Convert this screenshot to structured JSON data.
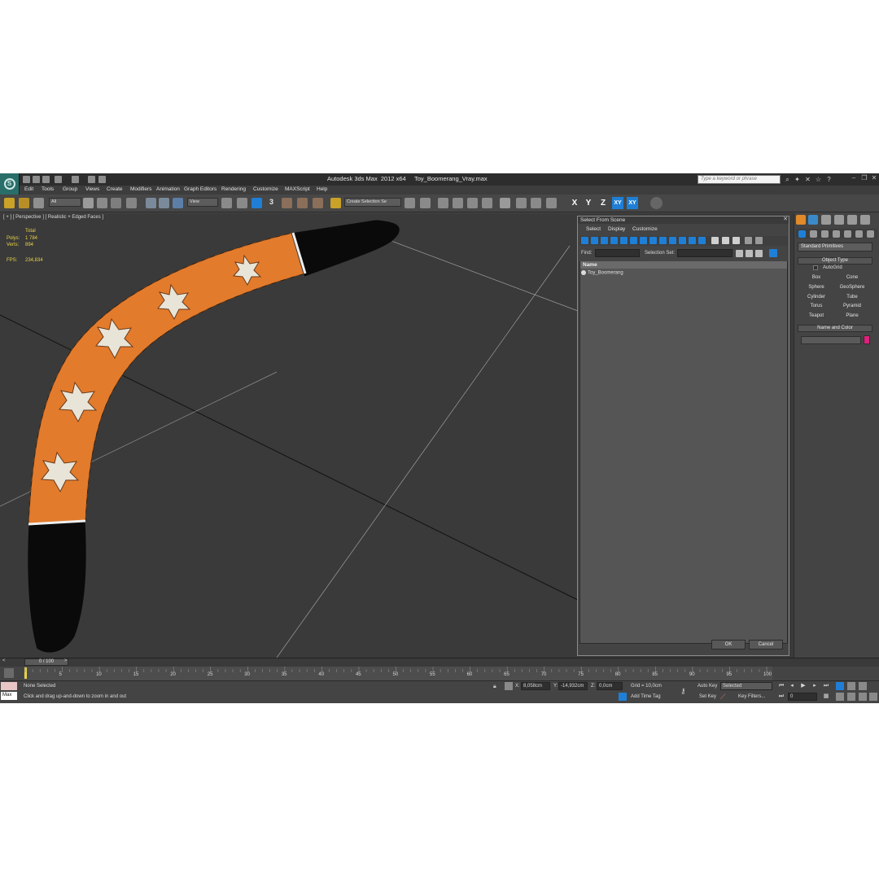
{
  "app": {
    "title": "Autodesk 3ds Max  2012 x64     Toy_Boomerang_Vray.max",
    "search_placeholder": "Type a keyword or phrase",
    "logo_letter": "S"
  },
  "menu": [
    "Edit",
    "Tools",
    "Group",
    "Views",
    "Create",
    "Modifiers",
    "Animation",
    "Graph Editors",
    "Rendering",
    "Customize",
    "MAXScript",
    "Help"
  ],
  "toolbar": {
    "filter_dropdown": "All",
    "coord_dropdown": "View",
    "snap_label": "3",
    "selection_set_placeholder": "Create Selection Se",
    "axes": [
      "X",
      "Y",
      "Z",
      "XY",
      "XY"
    ]
  },
  "viewport": {
    "label": "[ + ] [ Perspective ] [ Realistic + Edged Faces ]",
    "stats": {
      "total_label": "Total",
      "polys_label": "Polys:",
      "polys_value": "1 784",
      "verts_label": "Verts:",
      "verts_value": "894",
      "fps_label": "FPS:",
      "fps_value": "234,834"
    }
  },
  "dialog": {
    "title": "Select From Scene",
    "menu": [
      "Select",
      "Display",
      "Customize"
    ],
    "find_label": "Find:",
    "selection_set_label": "Selection Set:",
    "column_name": "Name",
    "items": [
      "Toy_Boomerang"
    ],
    "ok_label": "OK",
    "cancel_label": "Cancel"
  },
  "command_panel": {
    "category": "Standard Primitives",
    "object_type_title": "Object Type",
    "autogrid_label": "AutoGrid",
    "primitives": [
      "Box",
      "Cone",
      "Sphere",
      "GeoSphere",
      "Cylinder",
      "Tube",
      "Torus",
      "Pyramid",
      "Teapot",
      "Plane"
    ],
    "name_color_title": "Name and Color",
    "object_color": "#e0207a"
  },
  "timeline": {
    "frame_display": "0 / 100",
    "ticks": [
      "0",
      "5",
      "10",
      "15",
      "20",
      "25",
      "30",
      "35",
      "40",
      "45",
      "50",
      "55",
      "60",
      "65",
      "70",
      "75",
      "80",
      "85",
      "90",
      "95",
      "100"
    ]
  },
  "status": {
    "selection": "None Selected",
    "prompt": "Click and drag up-and-down to zoom in and out",
    "maxscript_label": "Max",
    "x_label": "X:",
    "x_value": "8,058cm",
    "y_label": "Y:",
    "y_value": "-14,932cm",
    "z_label": "Z:",
    "z_value": "0,0cm",
    "grid": "Grid = 10,0cm",
    "add_time_tag": "Add Time Tag",
    "auto_key": "Auto Key",
    "set_key": "Set Key",
    "key_mode": "Selected",
    "key_filters": "Key Filters...",
    "current_frame": "0"
  },
  "colors": {
    "accent_blue": "#1f7fd6",
    "boomerang_orange": "#e37b2c",
    "stats_yellow": "#e8d24a"
  }
}
